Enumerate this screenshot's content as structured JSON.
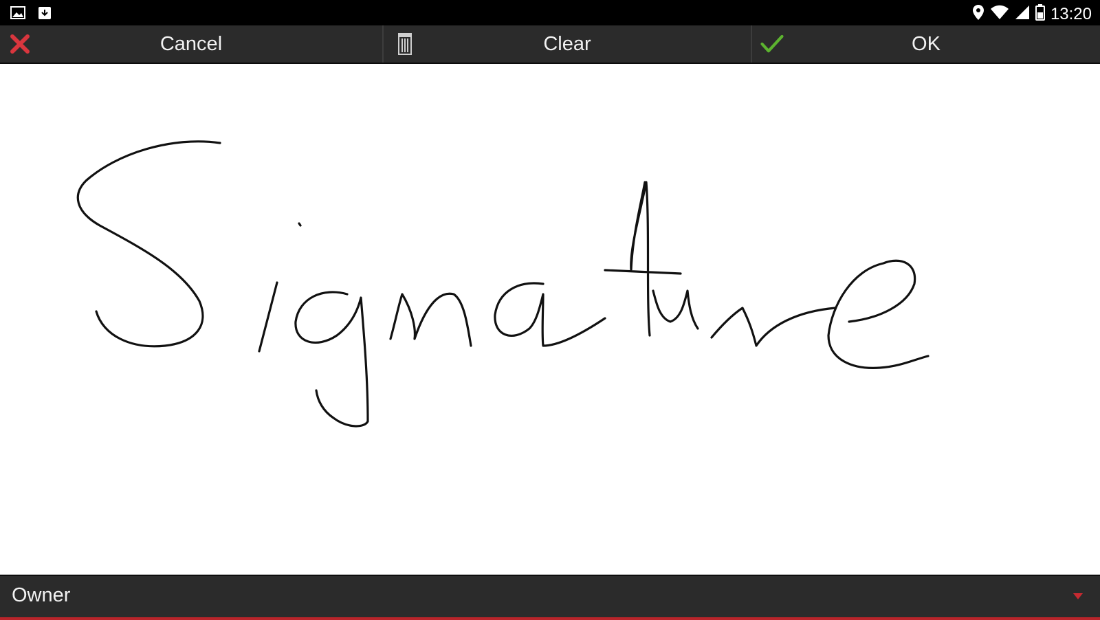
{
  "status_bar": {
    "time": "13:20",
    "left_icons": [
      "image-icon",
      "download-icon"
    ],
    "right_icons": [
      "location-icon",
      "wifi-icon",
      "cell-signal-icon",
      "battery-icon"
    ]
  },
  "toolbar": {
    "cancel_label": "Cancel",
    "clear_label": "Clear",
    "ok_label": "OK",
    "cancel_icon": "close-icon",
    "clear_icon": "trash-icon",
    "ok_icon": "check-icon"
  },
  "signature_pad": {
    "signature_text": "Signature"
  },
  "owner_select": {
    "selected": "Owner",
    "arrow_icon": "dropdown-arrow-icon"
  },
  "colors": {
    "cancel_icon": "#d9363e",
    "ok_icon": "#5cb32f",
    "accent_underline": "#b8242a",
    "toolbar_bg": "#2b2b2b"
  }
}
